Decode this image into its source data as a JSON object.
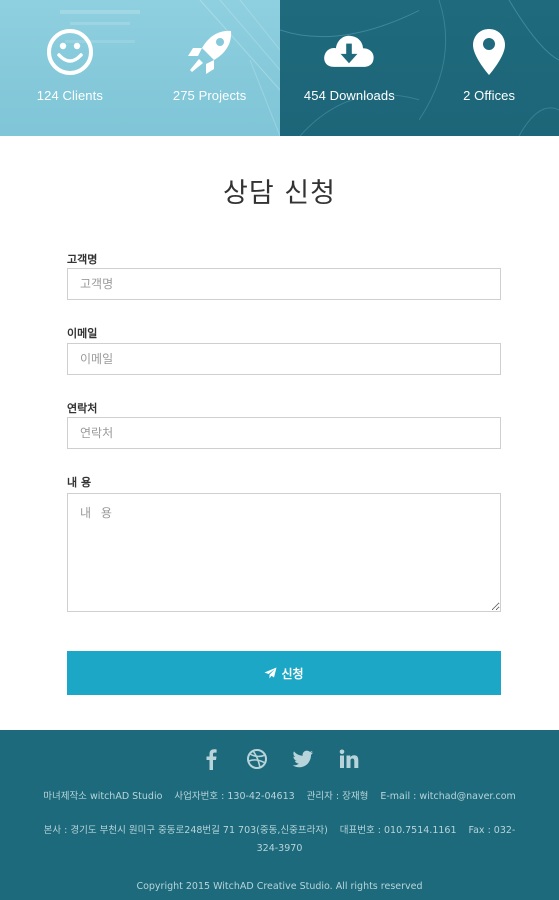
{
  "stats": [
    {
      "icon": "smiley-icon",
      "label": "124 Clients"
    },
    {
      "icon": "rocket-icon",
      "label": "275 Projects"
    },
    {
      "icon": "cloud-download-icon",
      "label": "454 Downloads"
    },
    {
      "icon": "map-pin-icon",
      "label": "2 Offices"
    }
  ],
  "form": {
    "title": "상담 신청",
    "fields": [
      {
        "label": "고객명",
        "placeholder": "고객명"
      },
      {
        "label": "이메일",
        "placeholder": "이메일"
      },
      {
        "label": "연락처",
        "placeholder": "연락처"
      },
      {
        "label": "내 용",
        "placeholder": "내 용"
      }
    ],
    "submit_label": "신청"
  },
  "footer": {
    "social": [
      "facebook-icon",
      "dribbble-icon",
      "twitter-icon",
      "linkedin-icon"
    ],
    "info_company": "마녀제작소 witchAD Studio",
    "info_bizno": "사업자번호 : 130-42-04613",
    "info_manager": "관리자 : 장재형",
    "info_email": "E-mail : witchad@naver.com",
    "address": "본사 : 경기도 부천시 원미구 중동로248번길 71 703(중동,신중프라자)",
    "phone": "대표번호 : 010.7514.1161",
    "fax": "Fax : 032-",
    "fax_cont": "324-3970",
    "copyright": "Copyright 2015 WitchAD Creative Studio. All rights reserved"
  },
  "colors": {
    "banner_light": "#85c9da",
    "banner_dark": "#1f6a7d",
    "accent": "#1ba7c5",
    "footer_bg": "#1c6a7b"
  }
}
